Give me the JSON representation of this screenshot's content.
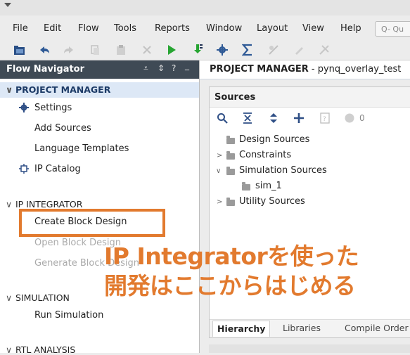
{
  "menubar": {
    "items": [
      "File",
      "Edit",
      "Flow",
      "Tools",
      "Reports",
      "Window",
      "Layout",
      "View",
      "Help"
    ],
    "quick_access_placeholder": "Q- Qu"
  },
  "flow_navigator": {
    "title": "Flow Navigator",
    "controls": [
      "⩡",
      "⇕",
      "?",
      "_"
    ],
    "sections": [
      {
        "name": "PROJECT MANAGER",
        "expanded": true
      },
      {
        "name": "IP INTEGRATOR",
        "expanded": true
      },
      {
        "name": "SIMULATION",
        "expanded": true
      },
      {
        "name": "RTL ANALYSIS",
        "expanded": true
      }
    ],
    "project_manager_items": [
      "Settings",
      "Add Sources",
      "Language Templates",
      "IP Catalog"
    ],
    "ip_integrator_items": [
      "Create Block Design",
      "Open Block Design",
      "Generate Block Design"
    ],
    "simulation_items": [
      "Run Simulation"
    ]
  },
  "project_header": {
    "label": "PROJECT MANAGER",
    "separator": " - ",
    "project_name": "pynq_overlay_test"
  },
  "sources": {
    "title": "Sources",
    "count": "0",
    "tree": [
      "Design Sources",
      "Constraints",
      "Simulation Sources",
      "sim_1",
      "Utility Sources"
    ],
    "tabs": [
      "Hierarchy",
      "Libraries",
      "Compile Order"
    ]
  },
  "annotation": {
    "line1": "IP Integratorを使った",
    "line2": "開発はここからはじめる"
  },
  "colors": {
    "accent_orange": "#e27a2e",
    "nav_header": "#3f4a55",
    "section_highlight": "#dde8f6"
  }
}
